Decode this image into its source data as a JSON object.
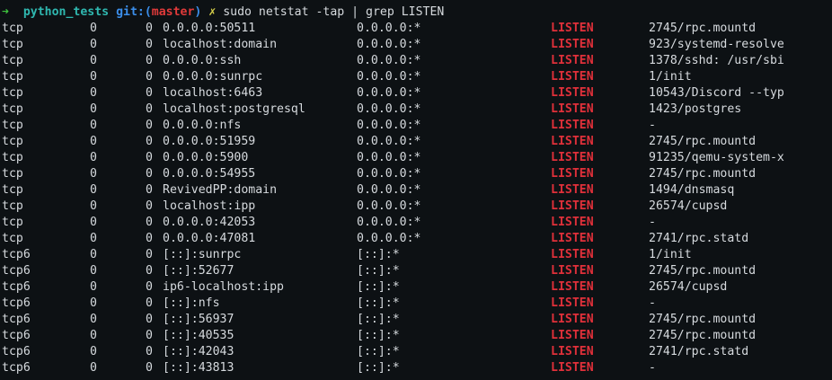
{
  "prompt": {
    "arrow": "➜",
    "directory": "python_tests",
    "git_prefix": "git:(",
    "branch": "master",
    "git_suffix": ")",
    "dirty_marker": "✗",
    "command": "sudo netstat -tap | grep LISTEN"
  },
  "rows": [
    {
      "proto": "tcp",
      "recv_q": "0",
      "send_q": "0",
      "local": "0.0.0.0:50511",
      "foreign": "0.0.0.0:*",
      "state": "LISTEN",
      "program": "2745/rpc.mountd"
    },
    {
      "proto": "tcp",
      "recv_q": "0",
      "send_q": "0",
      "local": "localhost:domain",
      "foreign": "0.0.0.0:*",
      "state": "LISTEN",
      "program": "923/systemd-resolve"
    },
    {
      "proto": "tcp",
      "recv_q": "0",
      "send_q": "0",
      "local": "0.0.0.0:ssh",
      "foreign": "0.0.0.0:*",
      "state": "LISTEN",
      "program": "1378/sshd: /usr/sbi"
    },
    {
      "proto": "tcp",
      "recv_q": "0",
      "send_q": "0",
      "local": "0.0.0.0:sunrpc",
      "foreign": "0.0.0.0:*",
      "state": "LISTEN",
      "program": "1/init"
    },
    {
      "proto": "tcp",
      "recv_q": "0",
      "send_q": "0",
      "local": "localhost:6463",
      "foreign": "0.0.0.0:*",
      "state": "LISTEN",
      "program": "10543/Discord --typ"
    },
    {
      "proto": "tcp",
      "recv_q": "0",
      "send_q": "0",
      "local": "localhost:postgresql",
      "foreign": "0.0.0.0:*",
      "state": "LISTEN",
      "program": "1423/postgres"
    },
    {
      "proto": "tcp",
      "recv_q": "0",
      "send_q": "0",
      "local": "0.0.0.0:nfs",
      "foreign": "0.0.0.0:*",
      "state": "LISTEN",
      "program": "-"
    },
    {
      "proto": "tcp",
      "recv_q": "0",
      "send_q": "0",
      "local": "0.0.0.0:51959",
      "foreign": "0.0.0.0:*",
      "state": "LISTEN",
      "program": "2745/rpc.mountd"
    },
    {
      "proto": "tcp",
      "recv_q": "0",
      "send_q": "0",
      "local": "0.0.0.0:5900",
      "foreign": "0.0.0.0:*",
      "state": "LISTEN",
      "program": "91235/qemu-system-x"
    },
    {
      "proto": "tcp",
      "recv_q": "0",
      "send_q": "0",
      "local": "0.0.0.0:54955",
      "foreign": "0.0.0.0:*",
      "state": "LISTEN",
      "program": "2745/rpc.mountd"
    },
    {
      "proto": "tcp",
      "recv_q": "0",
      "send_q": "0",
      "local": "RevivedPP:domain",
      "foreign": "0.0.0.0:*",
      "state": "LISTEN",
      "program": "1494/dnsmasq"
    },
    {
      "proto": "tcp",
      "recv_q": "0",
      "send_q": "0",
      "local": "localhost:ipp",
      "foreign": "0.0.0.0:*",
      "state": "LISTEN",
      "program": "26574/cupsd"
    },
    {
      "proto": "tcp",
      "recv_q": "0",
      "send_q": "0",
      "local": "0.0.0.0:42053",
      "foreign": "0.0.0.0:*",
      "state": "LISTEN",
      "program": "-"
    },
    {
      "proto": "tcp",
      "recv_q": "0",
      "send_q": "0",
      "local": "0.0.0.0:47081",
      "foreign": "0.0.0.0:*",
      "state": "LISTEN",
      "program": "2741/rpc.statd"
    },
    {
      "proto": "tcp6",
      "recv_q": "0",
      "send_q": "0",
      "local": "[::]:sunrpc",
      "foreign": "[::]:*",
      "state": "LISTEN",
      "program": "1/init"
    },
    {
      "proto": "tcp6",
      "recv_q": "0",
      "send_q": "0",
      "local": "[::]:52677",
      "foreign": "[::]:*",
      "state": "LISTEN",
      "program": "2745/rpc.mountd"
    },
    {
      "proto": "tcp6",
      "recv_q": "0",
      "send_q": "0",
      "local": "ip6-localhost:ipp",
      "foreign": "[::]:*",
      "state": "LISTEN",
      "program": "26574/cupsd"
    },
    {
      "proto": "tcp6",
      "recv_q": "0",
      "send_q": "0",
      "local": "[::]:nfs",
      "foreign": "[::]:*",
      "state": "LISTEN",
      "program": "-"
    },
    {
      "proto": "tcp6",
      "recv_q": "0",
      "send_q": "0",
      "local": "[::]:56937",
      "foreign": "[::]:*",
      "state": "LISTEN",
      "program": "2745/rpc.mountd"
    },
    {
      "proto": "tcp6",
      "recv_q": "0",
      "send_q": "0",
      "local": "[::]:40535",
      "foreign": "[::]:*",
      "state": "LISTEN",
      "program": "2745/rpc.mountd"
    },
    {
      "proto": "tcp6",
      "recv_q": "0",
      "send_q": "0",
      "local": "[::]:42043",
      "foreign": "[::]:*",
      "state": "LISTEN",
      "program": "2741/rpc.statd"
    },
    {
      "proto": "tcp6",
      "recv_q": "0",
      "send_q": "0",
      "local": "[::]:43813",
      "foreign": "[::]:*",
      "state": "LISTEN",
      "program": "-"
    }
  ],
  "colors": {
    "background": "#0d1114",
    "text": "#d6dade",
    "listen_state": "#e0303a",
    "prompt_arrow": "#3ec43e",
    "prompt_dir": "#2fb8b0",
    "git_label": "#3b8eea",
    "branch": "#e03a3a",
    "dirty_marker": "#d7d04a"
  }
}
